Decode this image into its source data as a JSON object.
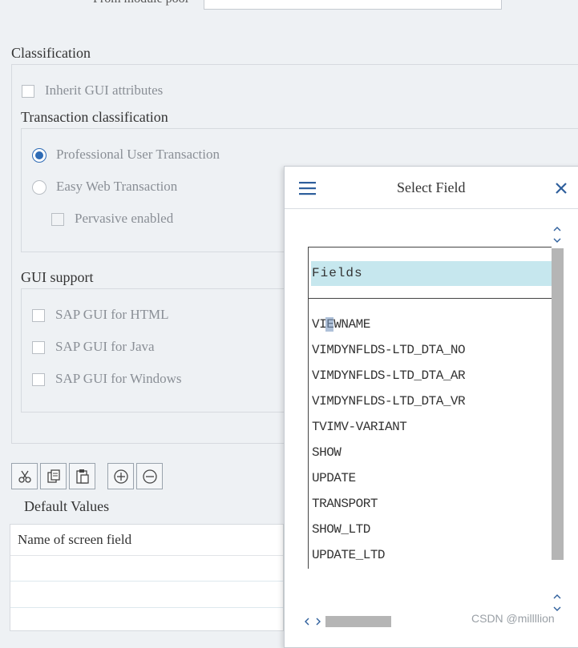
{
  "top": {
    "from_module_pool_label": "From module pool"
  },
  "classification": {
    "title": "Classification",
    "inherit_gui_label": "Inherit GUI attributes",
    "transaction_classification_title": "Transaction classification",
    "professional_label": "Professional User Transaction",
    "easy_web_label": "Easy Web Transaction",
    "pervasive_label": "Pervasive enabled",
    "selected_classification": "Professional User Transaction"
  },
  "gui_support": {
    "title": "GUI support",
    "html_label": "SAP GUI for HTML",
    "java_label": "SAP GUI for Java",
    "windows_label": "SAP GUI for Windows"
  },
  "toolbar": {
    "icons": [
      "cut-icon",
      "copy-icon",
      "paste-icon",
      "plus-circle-icon",
      "minus-circle-icon"
    ]
  },
  "default_values": {
    "title": "Default Values",
    "column_header": "Name of screen field"
  },
  "dialog": {
    "title": "Select Field",
    "list_header": "Fields",
    "fields": [
      "VIEWNAME",
      "VIMDYNFLDS-LTD_DTA_NO",
      "VIMDYNFLDS-LTD_DTA_AR",
      "VIMDYNFLDS-LTD_DTA_VR",
      "TVIMV-VARIANT",
      "SHOW",
      "UPDATE",
      "TRANSPORT",
      "SHOW_LTD",
      "UPDATE_LTD"
    ]
  },
  "watermark": "CSDN @millllion",
  "colors": {
    "accent": "#2e6bb5",
    "list_header_bg": "#c6e7ee",
    "scrollbar": "#b5b5b5"
  }
}
